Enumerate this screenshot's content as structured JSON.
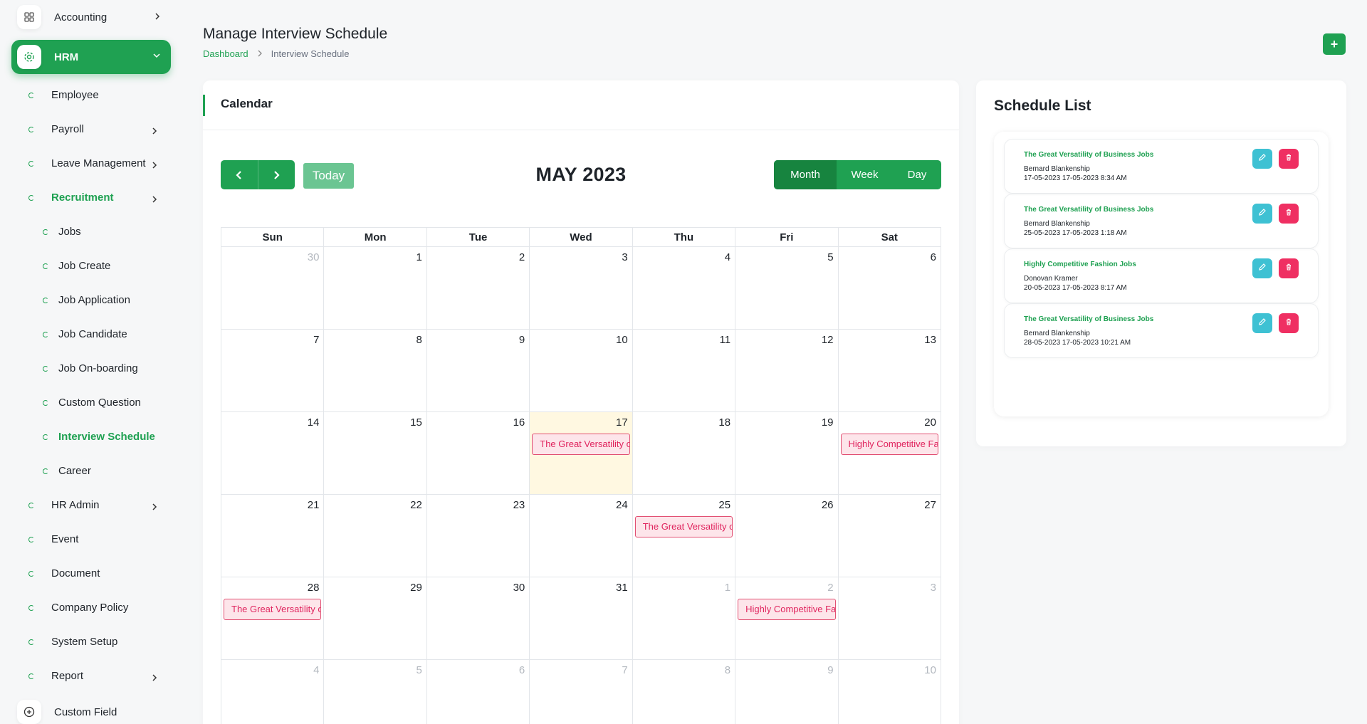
{
  "sidebar": {
    "accounting": "Accounting",
    "hrm": "HRM",
    "items": [
      {
        "label": "Employee"
      },
      {
        "label": "Payroll"
      },
      {
        "label": "Leave Management"
      },
      {
        "label": "Recruitment"
      },
      {
        "label": "HR Admin"
      },
      {
        "label": "Event"
      },
      {
        "label": "Document"
      },
      {
        "label": "Company Policy"
      },
      {
        "label": "System Setup"
      },
      {
        "label": "Report"
      }
    ],
    "recruitment_sub": [
      {
        "label": "Jobs"
      },
      {
        "label": "Job Create"
      },
      {
        "label": "Job Application"
      },
      {
        "label": "Job Candidate"
      },
      {
        "label": "Job On-boarding"
      },
      {
        "label": "Custom Question"
      },
      {
        "label": "Interview Schedule"
      },
      {
        "label": "Career"
      }
    ],
    "custom_field": "Custom Field"
  },
  "header": {
    "title": "Manage Interview Schedule",
    "breadcrumb": [
      "Dashboard",
      "Interview Schedule"
    ],
    "add_button": "+"
  },
  "calendar": {
    "card_title": "Calendar",
    "today_label": "Today",
    "month_label": "MAY 2023",
    "views": [
      "Month",
      "Week",
      "Day"
    ],
    "active_view": "Month",
    "weekdays": [
      "Sun",
      "Mon",
      "Tue",
      "Wed",
      "Thu",
      "Fri",
      "Sat"
    ],
    "weeks": [
      [
        {
          "d": "30",
          "o": true
        },
        {
          "d": "1"
        },
        {
          "d": "2"
        },
        {
          "d": "3"
        },
        {
          "d": "4"
        },
        {
          "d": "5"
        },
        {
          "d": "6"
        }
      ],
      [
        {
          "d": "7"
        },
        {
          "d": "8"
        },
        {
          "d": "9"
        },
        {
          "d": "10"
        },
        {
          "d": "11"
        },
        {
          "d": "12"
        },
        {
          "d": "13"
        }
      ],
      [
        {
          "d": "14"
        },
        {
          "d": "15"
        },
        {
          "d": "16"
        },
        {
          "d": "17",
          "t": true,
          "e": "The Great Versatility of Business Jobs"
        },
        {
          "d": "18"
        },
        {
          "d": "19"
        },
        {
          "d": "20",
          "e": "Highly Competitive Fashion Jobs"
        }
      ],
      [
        {
          "d": "21"
        },
        {
          "d": "22"
        },
        {
          "d": "23"
        },
        {
          "d": "24"
        },
        {
          "d": "25",
          "e": "The Great Versatility of Business Jobs"
        },
        {
          "d": "26"
        },
        {
          "d": "27"
        }
      ],
      [
        {
          "d": "28",
          "e": "The Great Versatility of Business Jobs"
        },
        {
          "d": "29"
        },
        {
          "d": "30"
        },
        {
          "d": "31"
        },
        {
          "d": "1",
          "o": true
        },
        {
          "d": "2",
          "o": true,
          "e": "Highly Competitive Fashion Jobs"
        },
        {
          "d": "3",
          "o": true
        }
      ],
      [
        {
          "d": "4",
          "o": true
        },
        {
          "d": "5",
          "o": true
        },
        {
          "d": "6",
          "o": true
        },
        {
          "d": "7",
          "o": true
        },
        {
          "d": "8",
          "o": true
        },
        {
          "d": "9",
          "o": true
        },
        {
          "d": "10",
          "o": true
        }
      ]
    ]
  },
  "schedule": {
    "title": "Schedule List",
    "items": [
      {
        "job": "The Great Versatility of Business Jobs",
        "person": "Bernard Blankenship",
        "dates": "17-05-2023 17-05-2023 8:34 AM"
      },
      {
        "job": "The Great Versatility of Business Jobs",
        "person": "Bernard Blankenship",
        "dates": "25-05-2023 17-05-2023 1:18 AM"
      },
      {
        "job": "Highly Competitive Fashion Jobs",
        "person": "Donovan Kramer",
        "dates": "20-05-2023 17-05-2023 8:17 AM"
      },
      {
        "job": "The Great Versatility of Business Jobs",
        "person": "Bernard Blankenship",
        "dates": "28-05-2023 17-05-2023 10:21 AM"
      }
    ]
  },
  "colors": {
    "accent": "#1fa152",
    "event_bg": "#fde5ea",
    "event_text": "#e0245e",
    "edit_btn": "#3ec1d3",
    "delete_btn": "#ef2f62",
    "today_bg": "#fff8e1"
  }
}
